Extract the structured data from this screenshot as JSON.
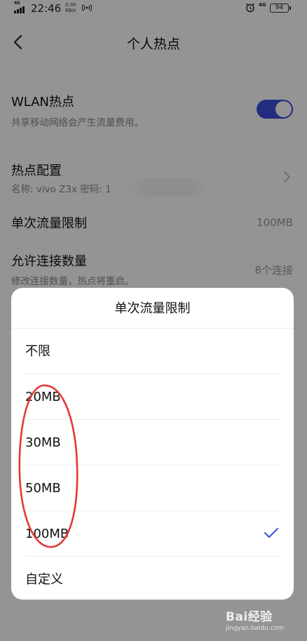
{
  "status_bar": {
    "network": "4G",
    "network_right": "4G",
    "time": "22:46",
    "speed_value": "0.00",
    "speed_unit": "KB/s",
    "battery": "94"
  },
  "header": {
    "title": "个人热点"
  },
  "settings": {
    "wlan_hotspot": {
      "title": "WLAN热点",
      "subtitle": "共享移动网络会产生流量费用。",
      "enabled": true
    },
    "hotspot_config": {
      "title": "热点配置",
      "subtitle": "名称: vivo Z3x  密码: 1"
    },
    "single_data_limit": {
      "title": "单次流量限制",
      "value": "100MB"
    },
    "max_connections": {
      "title": "允许连接数量",
      "subtitle": "修改连接数量，热点将重启。",
      "value": "8个连接"
    }
  },
  "sheet": {
    "title": "单次流量限制",
    "options": [
      {
        "label": "不限",
        "selected": false
      },
      {
        "label": "20MB",
        "selected": false
      },
      {
        "label": "30MB",
        "selected": false
      },
      {
        "label": "50MB",
        "selected": false
      },
      {
        "label": "100MB",
        "selected": true
      },
      {
        "label": "自定义",
        "selected": false
      }
    ]
  },
  "colors": {
    "accent": "#3b4fd9",
    "annotation": "#e53935"
  },
  "watermark": {
    "text": "Bai经验",
    "url": "jingyan.baidu.com"
  }
}
